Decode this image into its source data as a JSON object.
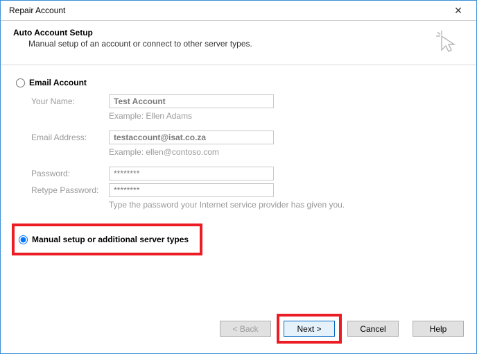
{
  "window": {
    "title": "Repair Account"
  },
  "header": {
    "heading": "Auto Account Setup",
    "sub": "Manual setup of an account or connect to other server types."
  },
  "options": {
    "emailAccount": {
      "label": "Email Account",
      "selected": false
    },
    "manualSetup": {
      "label": "Manual setup or additional server types",
      "selected": true
    }
  },
  "fields": {
    "yourName": {
      "label": "Your Name:",
      "value": "Test Account",
      "hint": "Example: Ellen Adams"
    },
    "email": {
      "label": "Email Address:",
      "value": "testaccount@isat.co.za",
      "hint": "Example: ellen@contoso.com"
    },
    "password": {
      "label": "Password:",
      "value": "********"
    },
    "retype": {
      "label": "Retype Password:",
      "value": "********",
      "hint": "Type the password your Internet service provider has given you."
    }
  },
  "buttons": {
    "back": "< Back",
    "next": "Next >",
    "cancel": "Cancel",
    "help": "Help"
  }
}
